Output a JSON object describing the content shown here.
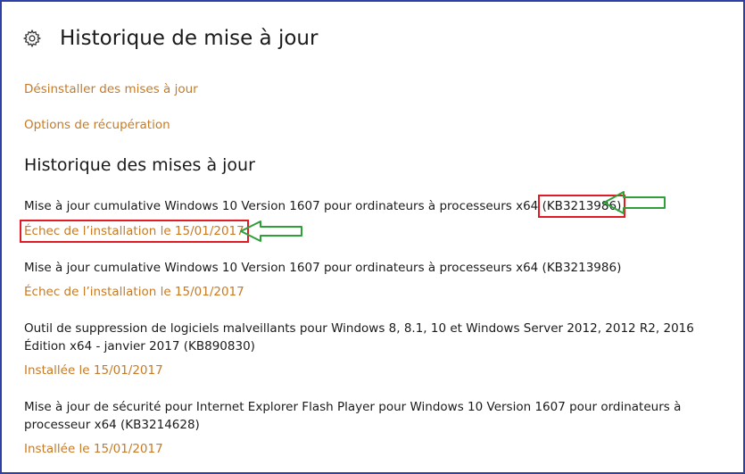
{
  "header": {
    "icon": "gear-icon",
    "title": "Historique de mise à jour"
  },
  "links": {
    "uninstall": "Désinstaller des mises à jour",
    "recovery": "Options de récupération"
  },
  "section": {
    "title": "Historique des mises à jour"
  },
  "updates": [
    {
      "title_prefix": "Mise à jour cumulative Windows 10 Version 1607 pour ordinateurs à processeurs x64 ",
      "kb": "(KB3213986)",
      "status": "Échec de l’installation le 15/01/2017"
    },
    {
      "title": "Mise à jour cumulative Windows 10 Version 1607 pour ordinateurs à processeurs x64 (KB3213986)",
      "status": "Échec de l’installation le 15/01/2017"
    },
    {
      "title": "Outil de suppression de logiciels malveillants pour Windows 8, 8.1, 10 et Windows Server 2012, 2012 R2, 2016 Édition x64 - janvier 2017 (KB890830)",
      "status": "Installée le 15/01/2017"
    },
    {
      "title": "Mise à jour de sécurité pour Internet Explorer Flash Player pour Windows 10 Version 1607 pour ordinateurs à processeur x64 (KB3214628)",
      "status": "Installée le 15/01/2017"
    }
  ],
  "colors": {
    "link": "#c87a22",
    "highlight_box": "#e01b24",
    "annotation_arrow": "#2ea03a",
    "frame": "#2f3fa8"
  }
}
